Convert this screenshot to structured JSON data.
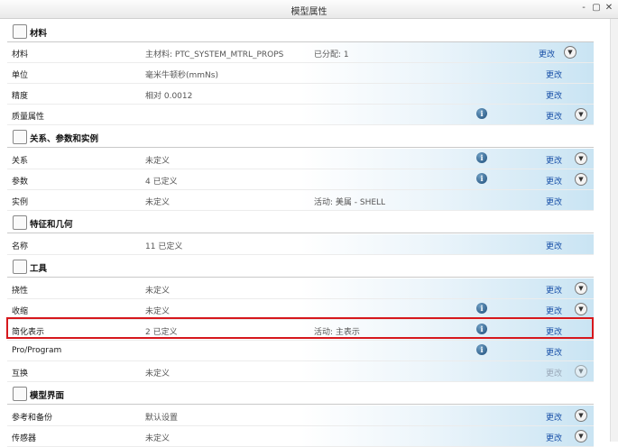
{
  "window": {
    "title": "模型属性",
    "controls": [
      "‑",
      "▢",
      "✕"
    ]
  },
  "icons": {
    "info": "info-icon",
    "expand": "chevron-down-icon",
    "highlight_color": "#d6181d"
  },
  "change_label": "更改",
  "sections": [
    {
      "id": "material",
      "title": "材料",
      "icon": "material-icon"
    },
    {
      "id": "relations",
      "title": "关系、参数和实例",
      "icon": "relations-icon"
    },
    {
      "id": "features",
      "title": "特征和几何",
      "icon": "features-icon"
    },
    {
      "id": "tools",
      "title": "工具",
      "icon": "tools-icon"
    },
    {
      "id": "modelui",
      "title": "模型界面",
      "icon": "model-interface-icon"
    }
  ],
  "rows": [
    {
      "label": "材料",
      "value": "主材料: PTC_SYSTEM_MTRL_PROPS",
      "extra": "已分配: 1"
    },
    {
      "label": "单位",
      "value": "毫米牛顿秒(mmNs)"
    },
    {
      "label": "精度",
      "value": "相对 0.0012"
    },
    {
      "label": "质量属性",
      "value": ""
    },
    {
      "label": "关系",
      "value": "未定义"
    },
    {
      "label": "参数",
      "value": "4 已定义"
    },
    {
      "label": "实例",
      "value": "未定义",
      "extra": "活动: 美属 - SHELL"
    },
    {
      "label": "名称",
      "value": "11 已定义"
    },
    {
      "label": "挠性",
      "value": "未定义"
    },
    {
      "label": "收缩",
      "value": "未定义"
    },
    {
      "label": "简化表示",
      "value": "2 已定义",
      "extra": "活动: 主表示"
    },
    {
      "label": "Pro/Program",
      "value": ""
    },
    {
      "label": "互换",
      "value": "未定义"
    },
    {
      "label": "参考和备份",
      "value": "默认设置"
    },
    {
      "label": "传感器",
      "value": "未定义"
    }
  ]
}
